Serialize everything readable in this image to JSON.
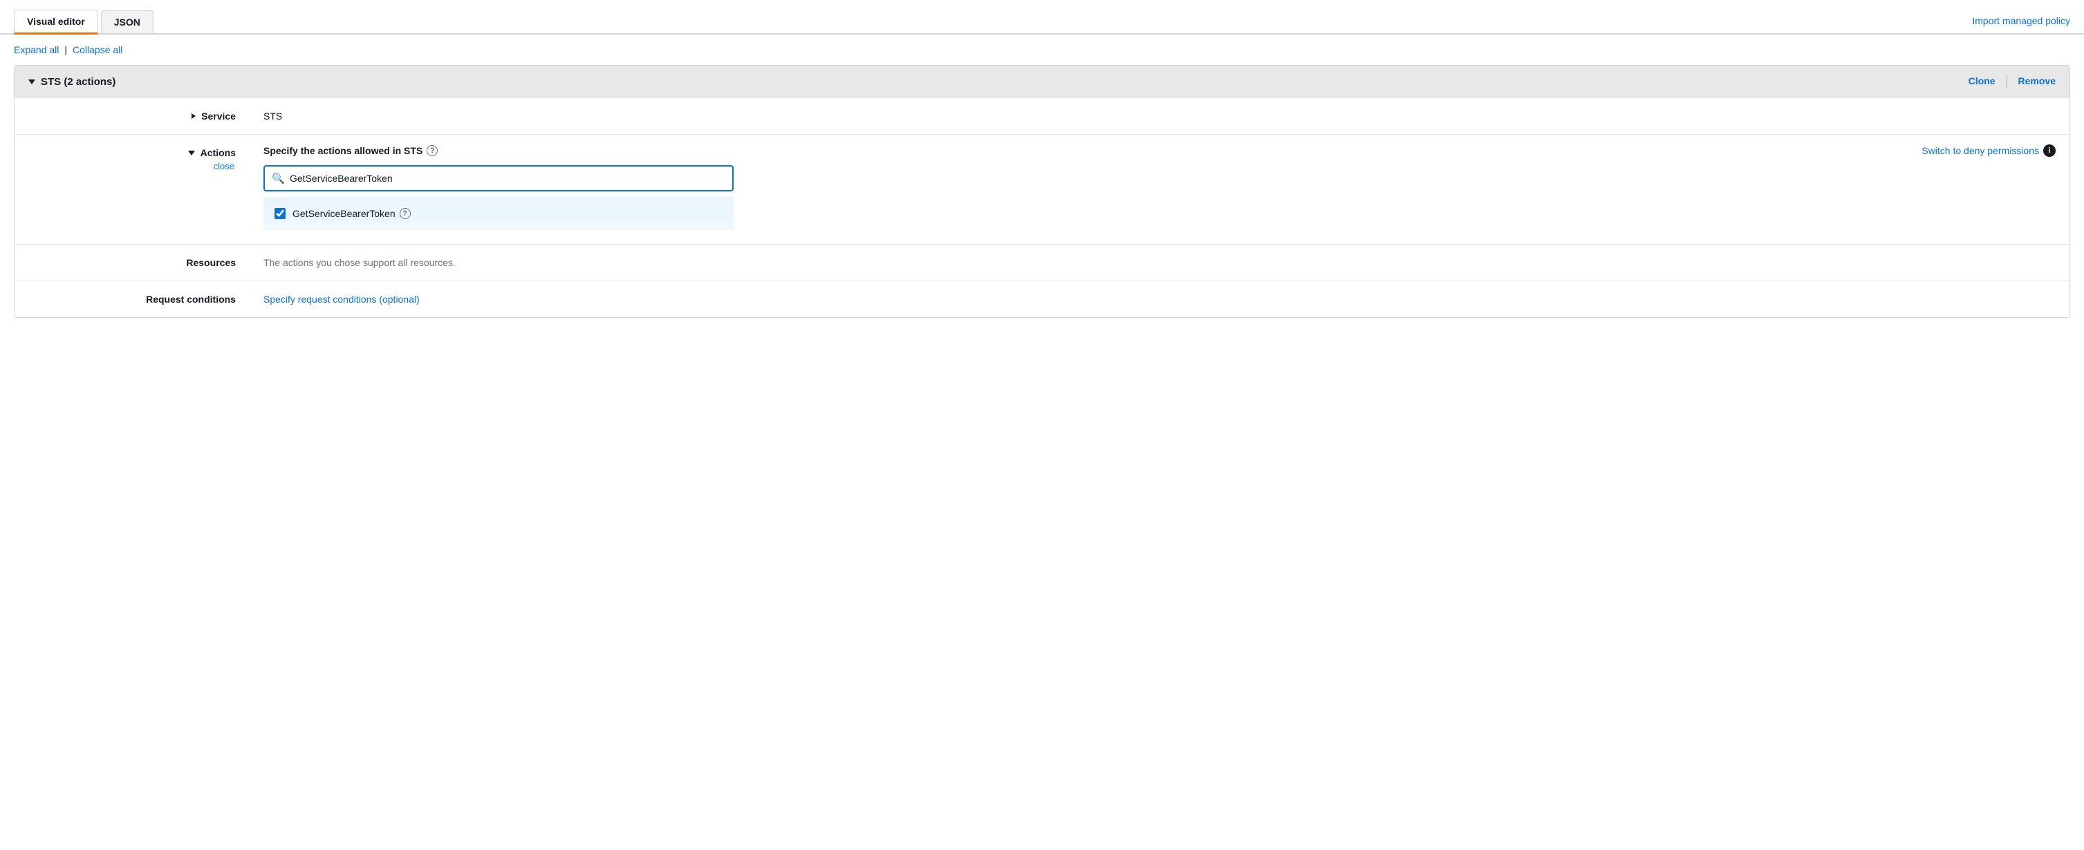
{
  "tabs": {
    "visual_editor": "Visual editor",
    "json": "JSON",
    "active": "visual_editor"
  },
  "header": {
    "import_link": "Import managed policy"
  },
  "toolbar": {
    "expand_all": "Expand all",
    "collapse_all": "Collapse all",
    "separator": "|"
  },
  "statement": {
    "title": "STS (2 actions)",
    "clone_label": "Clone",
    "remove_label": "Remove"
  },
  "service_row": {
    "label": "Service",
    "value": "STS"
  },
  "actions_row": {
    "label": "Actions",
    "close_label": "close",
    "title": "Specify the actions allowed in STS",
    "switch_deny_label": "Switch to deny permissions",
    "search_placeholder": "GetServiceBearerToken",
    "search_value": "GetServiceBearerToken",
    "items": [
      {
        "label": "GetServiceBearerToken",
        "checked": true
      }
    ]
  },
  "resources_row": {
    "label": "Resources",
    "value": "The actions you chose support all resources."
  },
  "conditions_row": {
    "label": "Request conditions",
    "link_label": "Specify request conditions (optional)"
  }
}
